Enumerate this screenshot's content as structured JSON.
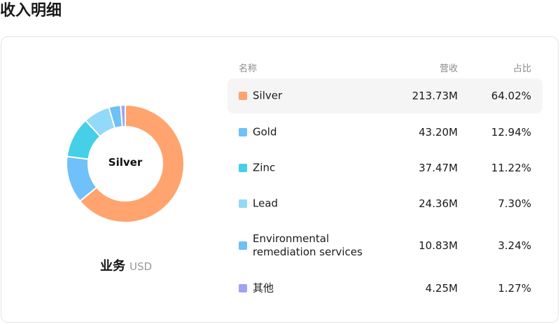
{
  "page": {
    "title": "收入明细"
  },
  "chart_data": {
    "type": "pie",
    "center_label": "Silver",
    "caption": "业务",
    "unit": "USD",
    "columns": [
      "名称",
      "营收",
      "占比"
    ],
    "series": [
      {
        "name": "Silver",
        "revenue": "213.73M",
        "percent": 64.02,
        "percent_label": "64.02%",
        "color": "#FFA46E"
      },
      {
        "name": "Gold",
        "revenue": "43.20M",
        "percent": 12.94,
        "percent_label": "12.94%",
        "color": "#70C0FA"
      },
      {
        "name": "Zinc",
        "revenue": "37.47M",
        "percent": 11.22,
        "percent_label": "11.22%",
        "color": "#45D0E8"
      },
      {
        "name": "Lead",
        "revenue": "24.36M",
        "percent": 7.3,
        "percent_label": "7.30%",
        "color": "#93D9F9"
      },
      {
        "name": "Environmental remediation services",
        "revenue": "10.83M",
        "percent": 3.24,
        "percent_label": "3.24%",
        "color": "#6EC0F5"
      },
      {
        "name": "其他",
        "revenue": "4.25M",
        "percent": 1.27,
        "percent_label": "1.27%",
        "color": "#A0A2F5"
      }
    ]
  }
}
